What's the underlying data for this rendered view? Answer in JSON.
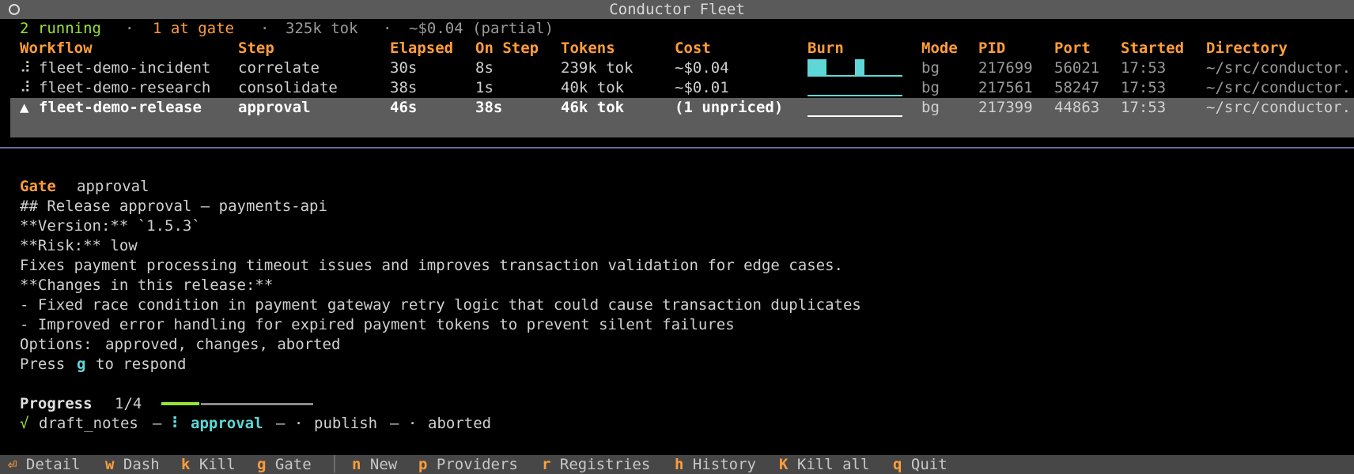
{
  "window": {
    "title": "Conductor Fleet"
  },
  "summary": {
    "running": "2 running",
    "dot1": "·",
    "gate": "1 at gate",
    "dot2": "·",
    "tokens": "325k tok",
    "dot3": "·",
    "cost": "~$0.04 (partial)"
  },
  "table": {
    "columns": [
      "Workflow",
      "Step",
      "Elapsed",
      "On Step",
      "Tokens",
      "Cost",
      "Burn",
      "Mode",
      "PID",
      "Port",
      "Started",
      "Directory"
    ],
    "rows": [
      {
        "icon": "⠼",
        "workflow": "fleet-demo-incident",
        "step": "correlate",
        "elapsed": "30s",
        "on_step": "8s",
        "tokens": "239k tok",
        "cost": "~$0.04",
        "mode": "bg",
        "pid": "217699",
        "port": "56021",
        "started": "17:53",
        "directory": "~/src/conductor."
      },
      {
        "icon": "⠼",
        "workflow": "fleet-demo-research",
        "step": "consolidate",
        "elapsed": "38s",
        "on_step": "1s",
        "tokens": "40k tok",
        "cost": "~$0.01",
        "mode": "bg",
        "pid": "217561",
        "port": "58247",
        "started": "17:53",
        "directory": "~/src/conductor."
      },
      {
        "icon": "▲",
        "workflow": "fleet-demo-release",
        "step": "approval",
        "elapsed": "46s",
        "on_step": "38s",
        "tokens": "46k tok",
        "cost": "(1 unpriced)",
        "mode": "bg",
        "pid": "217399",
        "port": "44863",
        "started": "17:53",
        "directory": "~/src/conductor."
      }
    ]
  },
  "colors": {
    "accent_orange": "#ff9d3b",
    "running_green": "#99e235",
    "burn_cyan": "#5fd7d7",
    "selection_bg": "#5c5c5c"
  },
  "detail": {
    "gate_label": "Gate",
    "gate_step": "approval",
    "lines": [
      "## Release approval — payments-api",
      "**Version:** `1.5.3`",
      "**Risk:** low",
      "Fixes payment processing timeout issues and improves transaction validation for edge cases.",
      "**Changes in this release:**",
      "- Fixed race condition in payment gateway retry logic that could cause transaction duplicates",
      "- Improved error handling for expired payment tokens to prevent silent failures"
    ],
    "options_label": "Options:",
    "options_value": "approved, changes, aborted",
    "press_prefix": "Press",
    "press_key": "g",
    "press_suffix": "to respond",
    "progress_label": "Progress",
    "progress_count": "1/4",
    "progress_fraction": 0.25,
    "pipeline": {
      "done_icon": "√",
      "done_step": "draft_notes",
      "sep1": "—",
      "current_icon": "⠇",
      "current_step": "approval",
      "sep2": "— ·",
      "next_step": "publish",
      "sep3": "— ·",
      "last_step": "aborted"
    }
  },
  "footer": {
    "items": [
      {
        "key": "⏎",
        "label": "Detail"
      },
      {
        "key": "w",
        "label": "Dash"
      },
      {
        "key": "k",
        "label": "Kill"
      },
      {
        "key": "g",
        "label": "Gate"
      },
      {
        "key": "n",
        "label": "New"
      },
      {
        "key": "p",
        "label": "Providers"
      },
      {
        "key": "r",
        "label": "Registries"
      },
      {
        "key": "h",
        "label": "History"
      },
      {
        "key": "K",
        "label": "Kill all"
      },
      {
        "key": "q",
        "label": "Quit"
      }
    ],
    "separator": "│"
  }
}
